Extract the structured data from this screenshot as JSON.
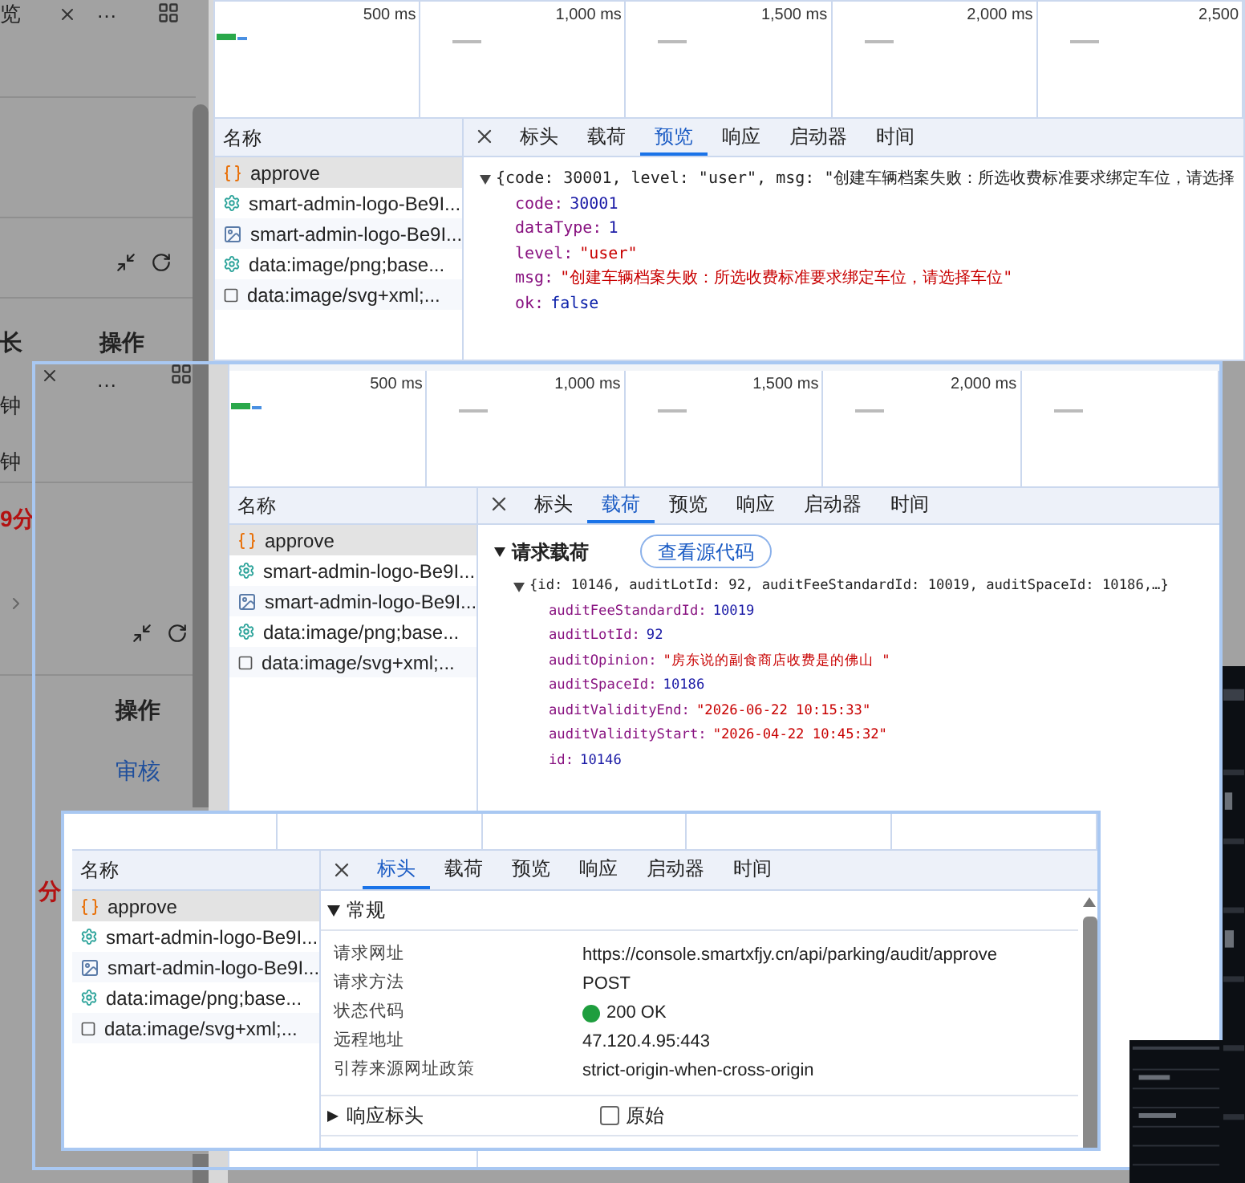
{
  "background_page": {
    "fragments": [
      {
        "text": "览",
        "kind": "plain"
      },
      {
        "text": "…",
        "kind": "plain"
      },
      {
        "text": "长",
        "kind": "bold"
      },
      {
        "text": "操作",
        "kind": "bold"
      },
      {
        "text": "…",
        "kind": "plain"
      },
      {
        "text": "钟",
        "kind": "plain"
      },
      {
        "text": "钟",
        "kind": "plain"
      },
      {
        "text": "9分",
        "kind": "red"
      },
      {
        "text": "操作",
        "kind": "bold"
      },
      {
        "text": "审核",
        "kind": "link"
      },
      {
        "text": "分",
        "kind": "red"
      }
    ]
  },
  "screenshots": [
    {
      "timeline": [
        "500 ms",
        "1,000 ms",
        "1,500 ms",
        "2,000 ms",
        "2,500"
      ],
      "list_header": "名称",
      "requests": [
        {
          "name": "approve",
          "kind": "fetch",
          "selected": true
        },
        {
          "name": "smart-admin-logo-Be9I...",
          "kind": "script",
          "selected": false
        },
        {
          "name": "smart-admin-logo-Be9I...",
          "kind": "image",
          "selected": false
        },
        {
          "name": "data:image/png;base...",
          "kind": "script",
          "selected": false
        },
        {
          "name": "data:image/svg+xml;...",
          "kind": "svg",
          "selected": false
        }
      ],
      "tabs": [
        {
          "label": "标头",
          "selected": false
        },
        {
          "label": "载荷",
          "selected": false
        },
        {
          "label": "预览",
          "selected": true
        },
        {
          "label": "响应",
          "selected": false
        },
        {
          "label": "启动器",
          "selected": false
        },
        {
          "label": "时间",
          "selected": false
        }
      ],
      "content": {
        "kind": "preview",
        "summary": "{code: 30001, level: \"user\", msg: \"创建车辆档案失败：所选收费标准要求绑定车位，请选择",
        "props": [
          {
            "key": "code:",
            "value": "30001",
            "kind": "number"
          },
          {
            "key": "dataType:",
            "value": "1",
            "kind": "number"
          },
          {
            "key": "level:",
            "value": "\"user\"",
            "kind": "string"
          },
          {
            "key": "msg:",
            "value": "\"创建车辆档案失败：所选收费标准要求绑定车位，请选择车位\"",
            "kind": "string"
          },
          {
            "key": "ok:",
            "value": "false",
            "kind": "bool"
          }
        ]
      }
    },
    {
      "timeline": [
        "500 ms",
        "1,000 ms",
        "1,500 ms",
        "2,000 ms"
      ],
      "list_header": "名称",
      "requests": [
        {
          "name": "approve",
          "kind": "fetch",
          "selected": true
        },
        {
          "name": "smart-admin-logo-Be9I...",
          "kind": "script",
          "selected": false
        },
        {
          "name": "smart-admin-logo-Be9I...",
          "kind": "image",
          "selected": false
        },
        {
          "name": "data:image/png;base...",
          "kind": "script",
          "selected": false
        },
        {
          "name": "data:image/svg+xml;...",
          "kind": "svg",
          "selected": false
        }
      ],
      "tabs": [
        {
          "label": "标头",
          "selected": false
        },
        {
          "label": "载荷",
          "selected": true
        },
        {
          "label": "预览",
          "selected": false
        },
        {
          "label": "响应",
          "selected": false
        },
        {
          "label": "启动器",
          "selected": false
        },
        {
          "label": "时间",
          "selected": false
        }
      ],
      "content": {
        "kind": "payload",
        "section": "请求载荷",
        "source_button": "查看源代码",
        "summary": "{id: 10146, auditLotId: 92, auditFeeStandardId: 10019, auditSpaceId: 10186,…}",
        "props": [
          {
            "key": "auditFeeStandardId:",
            "value": "10019",
            "kind": "number"
          },
          {
            "key": "auditLotId:",
            "value": "92",
            "kind": "number"
          },
          {
            "key": "auditOpinion:",
            "value": "\"房东说的副食商店收费是的佛山 \"",
            "kind": "string"
          },
          {
            "key": "auditSpaceId:",
            "value": "10186",
            "kind": "number"
          },
          {
            "key": "auditValidityEnd:",
            "value": "\"2026-06-22 10:15:33\"",
            "kind": "string"
          },
          {
            "key": "auditValidityStart:",
            "value": "\"2026-04-22 10:45:32\"",
            "kind": "string"
          },
          {
            "key": "id:",
            "value": "10146",
            "kind": "number"
          }
        ]
      }
    },
    {
      "list_header": "名称",
      "requests": [
        {
          "name": "approve",
          "kind": "fetch",
          "selected": true
        },
        {
          "name": "smart-admin-logo-Be9I...",
          "kind": "script",
          "selected": false
        },
        {
          "name": "smart-admin-logo-Be9I...",
          "kind": "image",
          "selected": false
        },
        {
          "name": "data:image/png;base...",
          "kind": "script",
          "selected": false
        },
        {
          "name": "data:image/svg+xml;...",
          "kind": "svg",
          "selected": false
        }
      ],
      "tabs": [
        {
          "label": "标头",
          "selected": true
        },
        {
          "label": "载荷",
          "selected": false
        },
        {
          "label": "预览",
          "selected": false
        },
        {
          "label": "响应",
          "selected": false
        },
        {
          "label": "启动器",
          "selected": false
        },
        {
          "label": "时间",
          "selected": false
        }
      ],
      "content": {
        "kind": "headers",
        "sections": [
          {
            "title": "常规",
            "expanded": true,
            "rows": [
              {
                "label": "请求网址",
                "value": "https://console.smartxfjy.cn/api/parking/audit/approve",
                "kind": "text"
              },
              {
                "label": "请求方法",
                "value": "POST",
                "kind": "text"
              },
              {
                "label": "状态代码",
                "value": "200 OK",
                "kind": "status"
              },
              {
                "label": "远程地址",
                "value": "47.120.4.95:443",
                "kind": "text"
              },
              {
                "label": "引荐来源网址政策",
                "value": "strict-origin-when-cross-origin",
                "kind": "text"
              }
            ]
          },
          {
            "title": "响应标头",
            "expanded": false,
            "raw_label": "原始",
            "raw_checked": false
          }
        ]
      }
    }
  ]
}
